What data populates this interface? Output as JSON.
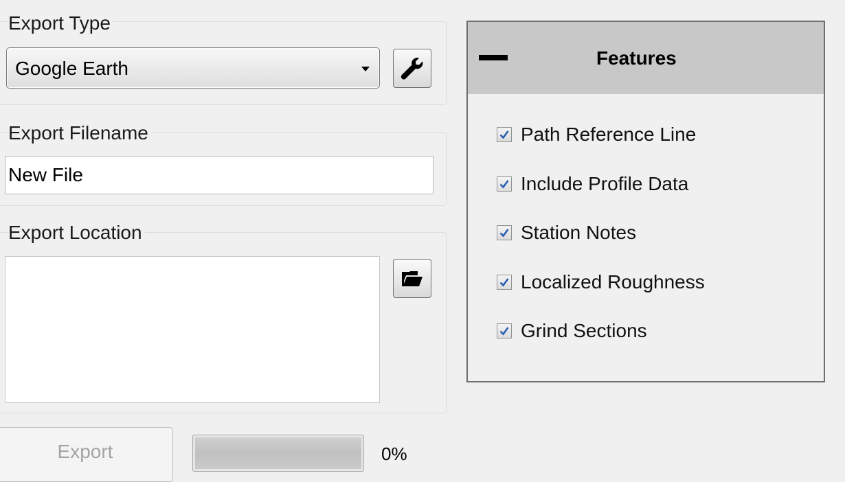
{
  "export_type": {
    "label": "Export Type",
    "selected": "Google Earth",
    "settings_icon": "wrench-icon"
  },
  "export_filename": {
    "label": "Export Filename",
    "value": "New File",
    "placeholder": ""
  },
  "export_location": {
    "label": "Export Location",
    "value": "",
    "browse_icon": "folder-open-icon"
  },
  "actions": {
    "export_label": "Export",
    "export_enabled": false
  },
  "progress": {
    "value": 0,
    "text": "0%"
  },
  "features": {
    "title": "Features",
    "collapse_icon": "minus-icon",
    "items": [
      {
        "label": "Path Reference Line",
        "checked": true
      },
      {
        "label": "Include Profile Data",
        "checked": true
      },
      {
        "label": "Station Notes",
        "checked": true
      },
      {
        "label": "Localized Roughness",
        "checked": true
      },
      {
        "label": "Grind Sections",
        "checked": true
      }
    ]
  },
  "colors": {
    "window_bg": "#f0f0f0",
    "panel_header_bg": "#c8c8c8",
    "check_mark": "#2a5fb0",
    "disabled_text": "#a3a3a3"
  }
}
